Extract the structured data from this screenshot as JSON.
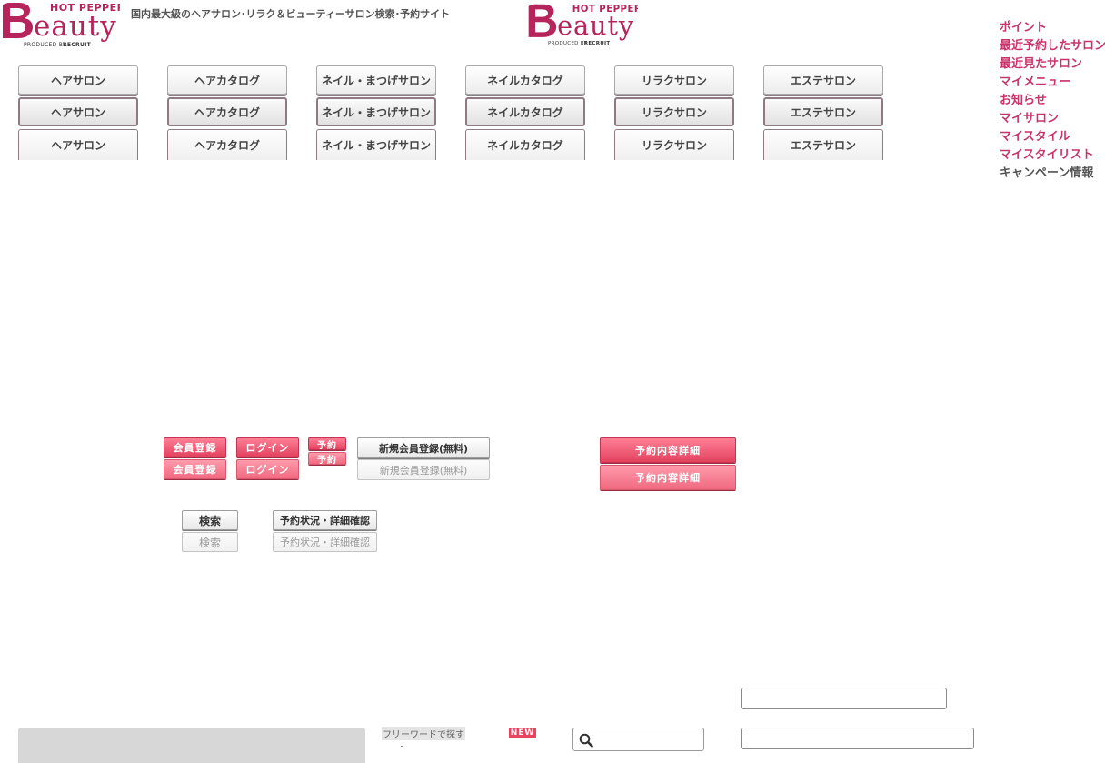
{
  "brand": {
    "hot_pepper": "HOT PEPPER",
    "beauty": "eauty",
    "produced_by": "PRODUCED BY",
    "recruit": "RECRUIT",
    "color": "#b5245b"
  },
  "header": {
    "tagline": "国内最大級のヘアサロン･リラク＆ビューティーサロン検索･予約サイト"
  },
  "tabs": {
    "labels": [
      "ヘアサロン",
      "ヘアカタログ",
      "ネイル・まつげサロン",
      "ネイルカタログ",
      "リラクサロン",
      "エステサロン"
    ]
  },
  "right_nav": {
    "items": [
      "ポイント",
      "最近予約したサロン",
      "最近見たサロン",
      "マイメニュー",
      "お知らせ",
      "マイサロン",
      "マイスタイル",
      "マイスタイリスト",
      "キャンペーン情報"
    ],
    "accent": "#c8356b"
  },
  "buttons": {
    "member_register": "会員登録",
    "login": "ログイン",
    "reserve": "予約",
    "new_member_free": "新規会員登録(無料)",
    "reservation_detail": "予約内容詳細",
    "search": "検索",
    "reservation_status": "予約状況・詳細確認"
  },
  "search_area": {
    "free_word_label": "フリーワードで探す",
    "new_badge": "NEW",
    "search_value": "",
    "field1_value": "",
    "field2_value": ""
  }
}
